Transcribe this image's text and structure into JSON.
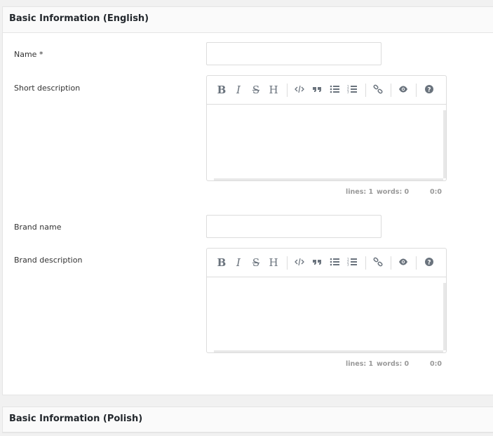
{
  "sections": [
    {
      "title": "Basic Information (English)"
    },
    {
      "title": "Basic Information (Polish)"
    }
  ],
  "fields": {
    "name": {
      "label": "Name *",
      "value": ""
    },
    "short_description": {
      "label": "Short description",
      "value": ""
    },
    "brand_name": {
      "label": "Brand name",
      "value": ""
    },
    "brand_description": {
      "label": "Brand description",
      "value": ""
    }
  },
  "toolbar": {
    "bold": "B",
    "italic": "I",
    "strike": "S",
    "heading": "H"
  },
  "editor_status": [
    {
      "lines": "lines: 1",
      "words": "words: 0",
      "cursor": "0:0"
    },
    {
      "lines": "lines: 1",
      "words": "words: 0",
      "cursor": "0:0"
    }
  ],
  "icons": [
    "bold-icon",
    "italic-icon",
    "strikethrough-icon",
    "heading-icon",
    "code-icon",
    "quote-icon",
    "unordered-list-icon",
    "ordered-list-icon",
    "link-icon",
    "preview-icon",
    "help-icon"
  ]
}
